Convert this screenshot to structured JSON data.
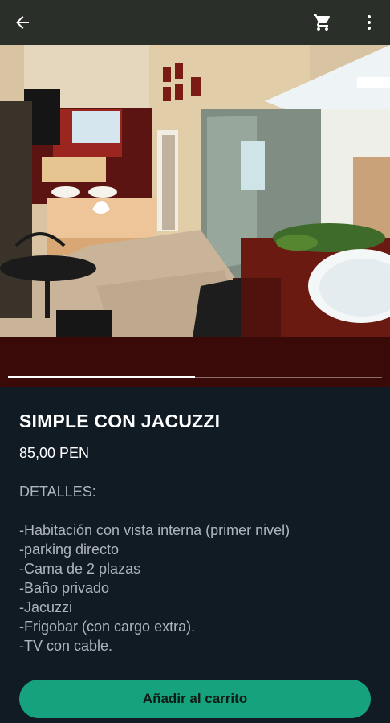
{
  "topbar": {
    "back_icon": "arrow-left-icon",
    "cart_icon": "shopping-cart-icon",
    "more_icon": "more-vertical-icon"
  },
  "product": {
    "title": "SIMPLE CON JACUZZI",
    "price": "85,00 PEN",
    "details_heading": "DETALLES:",
    "details": [
      "-Habitación con vista interna (primer nivel)",
      "-parking directo",
      "-Cama de 2 plazas",
      "-Baño privado",
      "-Jacuzzi",
      "-Frigobar (con cargo extra).",
      "-TV con cable."
    ]
  },
  "carousel": {
    "progress": 0.5
  },
  "actions": {
    "add_to_cart": "Añadir al carrito"
  },
  "colors": {
    "accent": "#16a27c",
    "background": "#111b24",
    "carousel_band": "#3a0a09"
  }
}
